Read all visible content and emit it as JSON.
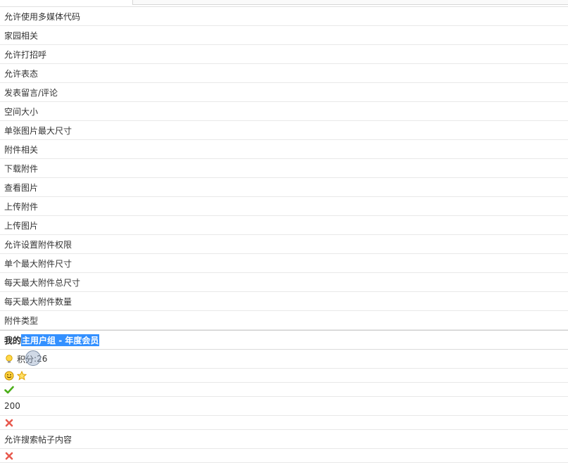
{
  "settings_rows": [
    "允许使用多媒体代码",
    "家园相关",
    "允许打招呼",
    "允许表态",
    "发表留言/评论",
    "空间大小",
    "单张图片最大尺寸",
    "附件相关",
    "下载附件",
    "查看图片",
    "上传附件",
    "上传图片",
    "允许设置附件权限",
    "单个最大附件尺寸",
    "每天最大附件总尺寸",
    "每天最大附件数量",
    "附件类型"
  ],
  "group_header": {
    "prefix": "我的",
    "group_name": "主用户组 - 年度会员"
  },
  "points": {
    "label": "积分",
    "separator": ":",
    "value": "26"
  },
  "values": {
    "number_value": "200",
    "search_row_label": "允许搜索帖子内容"
  },
  "icons": {
    "bulb": "lightbulb-icon",
    "smile": "smiley-icon",
    "star": "star-icon",
    "check": "check-icon",
    "cross": "cross-icon"
  },
  "colors": {
    "highlight": "#3390ff",
    "check": "#4caf1a",
    "cross": "#e85a4f",
    "star": "#f5b800"
  }
}
